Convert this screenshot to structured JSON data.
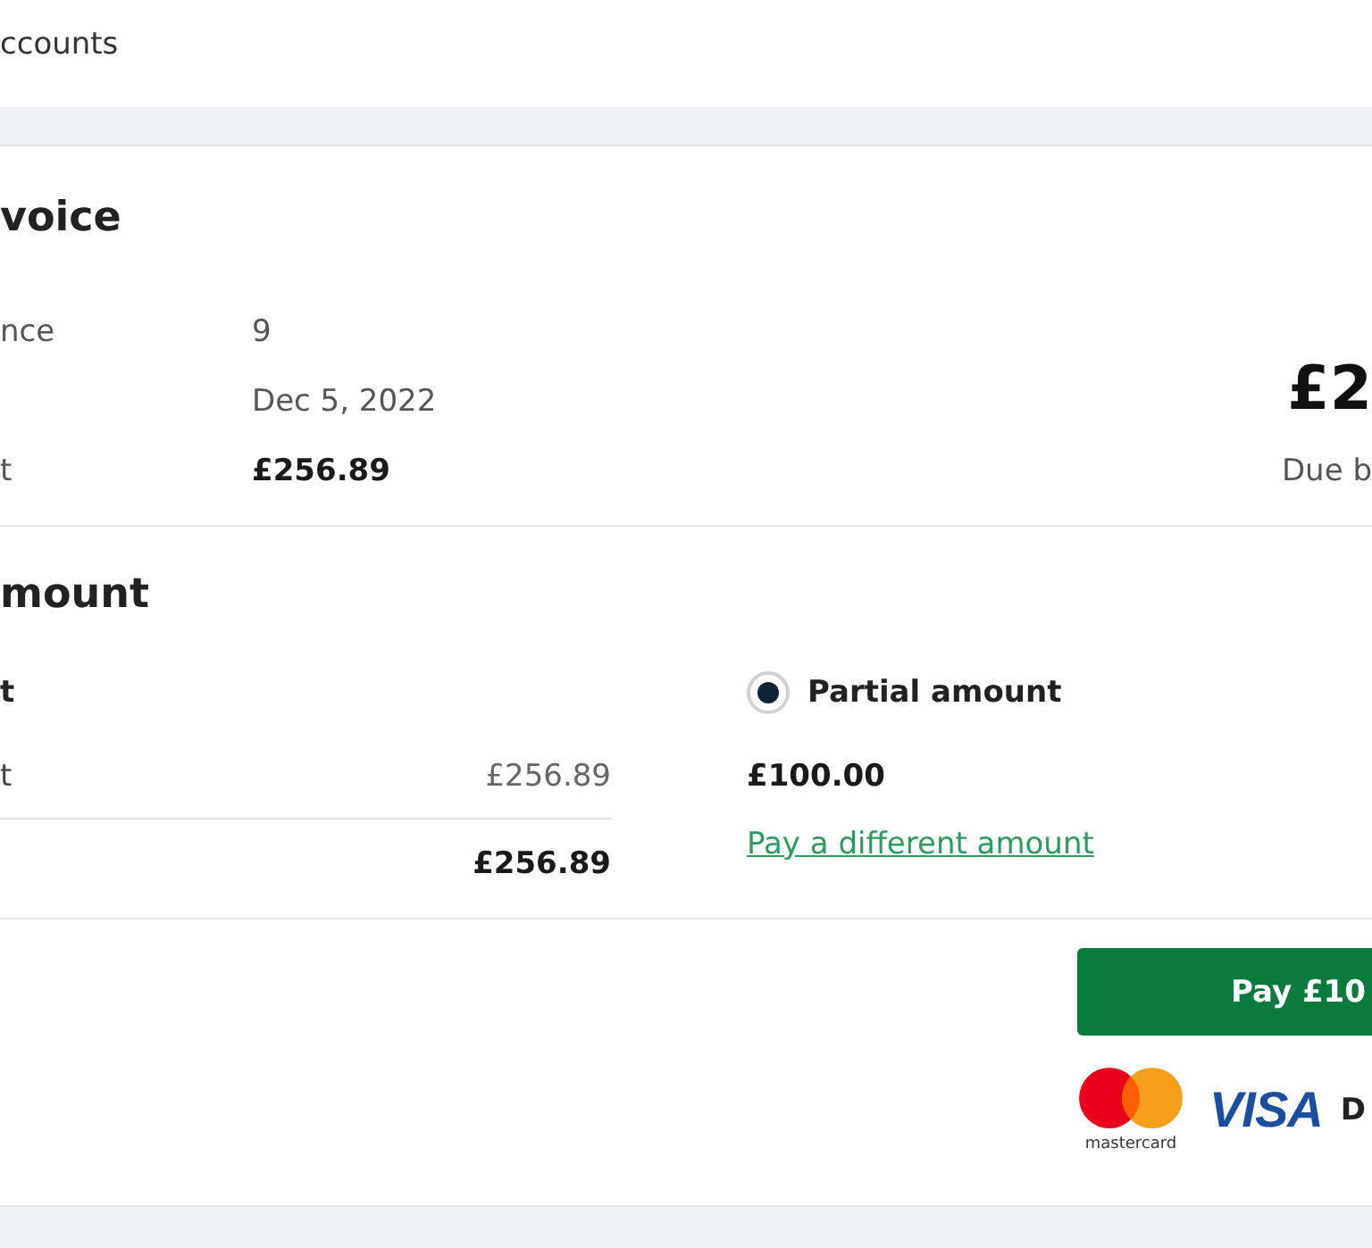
{
  "header": {
    "breadcrumb": "ccounts"
  },
  "invoice": {
    "title": "voice",
    "details": [
      {
        "kind": "plain",
        "label": "nce",
        "value": "9"
      },
      {
        "kind": "plain",
        "value": "Dec 5, 2022"
      },
      {
        "kind": "strong",
        "label": "t",
        "value": "£256.89"
      }
    ],
    "balance": {
      "amount": "£2",
      "caption": "Due b"
    }
  },
  "payment_amount": {
    "title": "mount",
    "full": {
      "label": "t",
      "lines": [
        {
          "kind": "item",
          "label": "t",
          "value": "£256.89"
        },
        {
          "kind": "total",
          "value": "£256.89"
        }
      ]
    },
    "partial": {
      "selected": true,
      "label": "Partial amount",
      "amount": "£100.00",
      "link": "Pay a different amount"
    }
  },
  "checkout": {
    "pay_button": "Pay £10",
    "card_logos": [
      {
        "kind": "mastercard",
        "caption": "mastercard"
      },
      {
        "kind": "visa",
        "text": "VISA"
      },
      {
        "kind": "text",
        "text": "D"
      }
    ]
  }
}
